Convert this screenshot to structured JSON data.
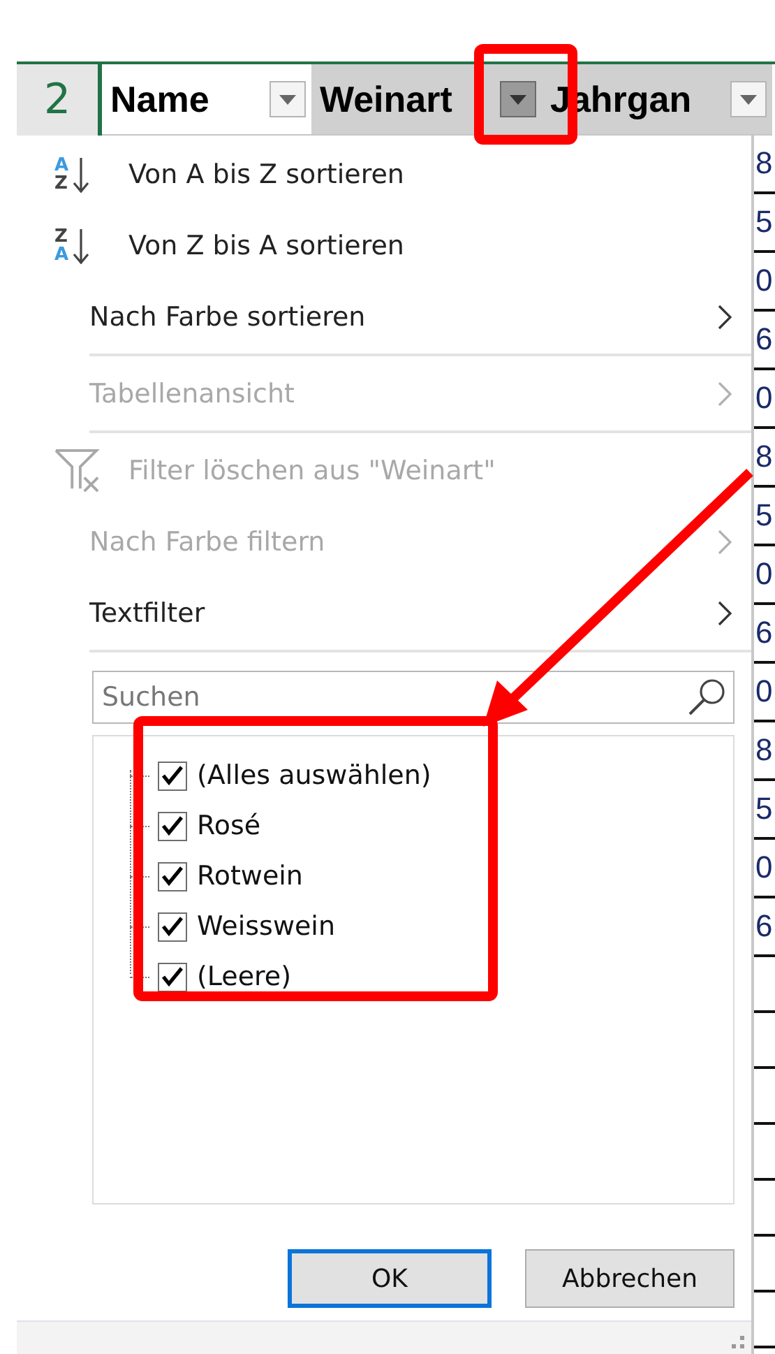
{
  "sheet": {
    "row_number": "2",
    "headers": [
      {
        "label": "Name",
        "selected": true,
        "filter_open": false
      },
      {
        "label": "Weinart",
        "selected": false,
        "filter_open": true
      },
      {
        "label": "Jahrgan",
        "selected": false,
        "filter_open": false
      }
    ],
    "partial_column": [
      "8",
      "5",
      "0",
      "6",
      "0",
      "8",
      "5",
      "0",
      "6",
      "0",
      "8",
      "5",
      "0",
      "6"
    ]
  },
  "filter_menu": {
    "items": [
      {
        "kind": "sort-ascending",
        "label": "Von A bis Z sortieren",
        "icon_top": "A",
        "icon_bottom": "Z",
        "disabled": false,
        "divider_after": false
      },
      {
        "kind": "sort-descending",
        "label": "Von Z bis A sortieren",
        "icon_top": "Z",
        "icon_bottom": "A",
        "disabled": false,
        "divider_after": false
      },
      {
        "kind": "submenu",
        "label": "Nach Farbe sortieren",
        "disabled": false,
        "divider_after": true
      },
      {
        "kind": "submenu",
        "label": "Tabellenansicht",
        "disabled": true,
        "divider_after": true
      },
      {
        "kind": "clear-filter",
        "label": "Filter löschen aus \"Weinart\"",
        "disabled": true,
        "divider_after": false
      },
      {
        "kind": "submenu",
        "label": "Nach Farbe filtern",
        "disabled": true,
        "divider_after": false
      },
      {
        "kind": "submenu",
        "label": "Textfilter",
        "disabled": false,
        "divider_after": true
      }
    ],
    "search": {
      "placeholder": "Suchen"
    },
    "values": [
      {
        "label": "(Alles auswählen)",
        "checked": true
      },
      {
        "label": "Rosé",
        "checked": true
      },
      {
        "label": "Rotwein",
        "checked": true
      },
      {
        "label": "Weisswein",
        "checked": true
      },
      {
        "label": "(Leere)",
        "checked": true
      }
    ],
    "buttons": [
      {
        "label": "OK",
        "default": true
      },
      {
        "label": "Abbrechen",
        "default": false
      }
    ]
  }
}
